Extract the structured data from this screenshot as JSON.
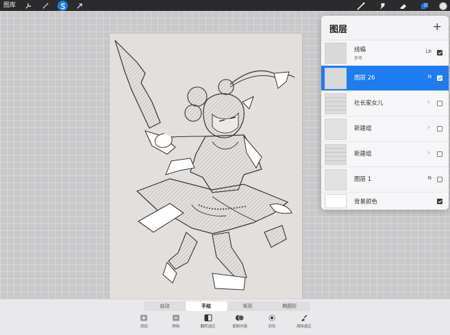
{
  "topbar": {
    "gallery_label": "图库",
    "left_tools": [
      {
        "name": "adjustments",
        "icon": "wrench-icon"
      },
      {
        "name": "selection-magic",
        "icon": "magic-wand-icon"
      },
      {
        "name": "selection",
        "icon": "selection-s-icon",
        "active": true
      },
      {
        "name": "transform",
        "icon": "arrow-cursor-icon"
      }
    ],
    "right_tools": [
      {
        "name": "brush",
        "icon": "brush-icon"
      },
      {
        "name": "smudge",
        "icon": "smudge-icon"
      },
      {
        "name": "eraser",
        "icon": "eraser-icon"
      },
      {
        "name": "layers",
        "icon": "layers-icon",
        "active": true
      }
    ],
    "accent": "#1e7bf0"
  },
  "layers": {
    "title": "图层",
    "add_symbol": "+",
    "items": [
      {
        "name": "线稿",
        "sub": "参考",
        "blend": "Lb",
        "checked": true,
        "thumb": "sketch"
      },
      {
        "name": "图层 26",
        "blend": "N",
        "checked": true,
        "selected": true,
        "thumb": "sketch"
      },
      {
        "name": "社长家女儿",
        "group": true,
        "checked": false,
        "thumb": "list"
      },
      {
        "name": "新建组",
        "group": true,
        "checked": false,
        "thumb": "plain"
      },
      {
        "name": "新建组",
        "group": true,
        "checked": false,
        "thumb": "list"
      },
      {
        "name": "图层 1",
        "blend": "N",
        "checked": false,
        "thumb": "plain"
      },
      {
        "name": "背景颜色",
        "checked": true,
        "thumb": "white"
      }
    ]
  },
  "selection_modes": {
    "items": [
      "自动",
      "手绘",
      "矩形",
      "椭圆形"
    ],
    "active_index": 1
  },
  "selection_actions": [
    {
      "label": "添加",
      "icon": "plus-box-icon"
    },
    {
      "label": "移除",
      "icon": "minus-box-icon"
    },
    {
      "label": "翻转选区",
      "icon": "invert-icon"
    },
    {
      "label": "复制内容",
      "icon": "copy-paste-icon"
    },
    {
      "label": "羽化",
      "icon": "feather-icon"
    },
    {
      "label": "清除选区",
      "icon": "clear-selection-icon"
    }
  ]
}
